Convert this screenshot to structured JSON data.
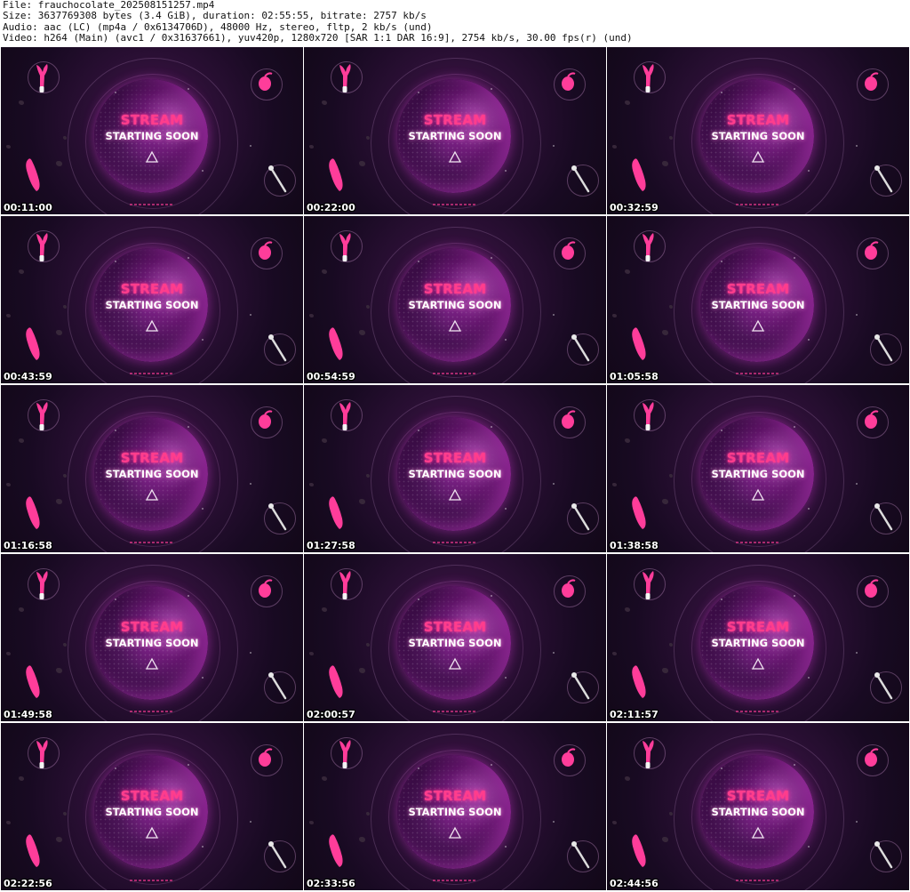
{
  "header": {
    "file": "File: frauchocolate_202508151257.mp4",
    "size": "Size: 3637769308 bytes (3.4 GiB), duration: 02:55:55, bitrate: 2757 kb/s",
    "audio": "Audio: aac (LC) (mp4a / 0x6134706D), 48000 Hz, stereo, fltp, 2 kb/s (und)",
    "video": "Video: h264 (Main) (avc1 / 0x31637661), yuv420p, 1280x720 [SAR 1:1 DAR 16:9], 2754 kb/s, 30.00 fps(r) (und)"
  },
  "frame_text": {
    "line1": "STREAM",
    "line2": "STARTING SOON"
  },
  "colors": {
    "accent_pink": "#ff3d8c",
    "background": "#1a0a22",
    "orb": "#5e1d6c"
  },
  "icons": [
    "rabbit-vibrator-icon",
    "egg-vibrator-icon",
    "curved-vibrator-icon",
    "wand-massager-icon",
    "play-triangle-icon"
  ],
  "thumbnails": [
    {
      "timestamp": "00:11:00"
    },
    {
      "timestamp": "00:22:00"
    },
    {
      "timestamp": "00:32:59"
    },
    {
      "timestamp": "00:43:59"
    },
    {
      "timestamp": "00:54:59"
    },
    {
      "timestamp": "01:05:58"
    },
    {
      "timestamp": "01:16:58"
    },
    {
      "timestamp": "01:27:58"
    },
    {
      "timestamp": "01:38:58"
    },
    {
      "timestamp": "01:49:58"
    },
    {
      "timestamp": "02:00:57"
    },
    {
      "timestamp": "02:11:57"
    },
    {
      "timestamp": "02:22:56"
    },
    {
      "timestamp": "02:33:56"
    },
    {
      "timestamp": "02:44:56"
    }
  ]
}
